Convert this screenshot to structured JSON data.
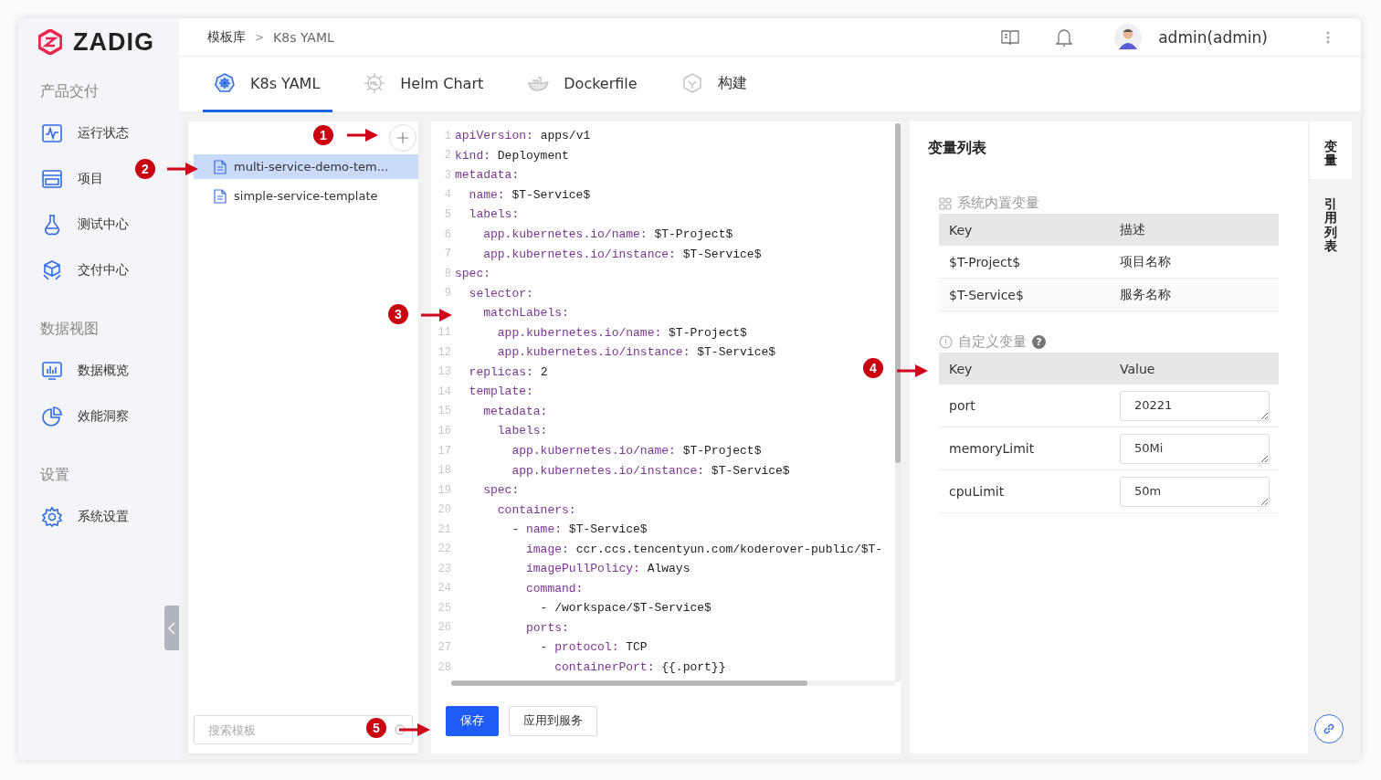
{
  "sidebar": {
    "logo": "ZADIG",
    "sections": [
      {
        "title": "产品交付",
        "items": [
          {
            "label": "运行状态"
          },
          {
            "label": "项目"
          },
          {
            "label": "测试中心"
          },
          {
            "label": "交付中心"
          }
        ]
      },
      {
        "title": "数据视图",
        "items": [
          {
            "label": "数据概览"
          },
          {
            "label": "效能洞察"
          }
        ]
      },
      {
        "title": "设置",
        "items": [
          {
            "label": "系统设置"
          }
        ]
      }
    ]
  },
  "header": {
    "breadcrumb": [
      "模板库",
      "K8s YAML"
    ],
    "separator": ">",
    "user": "admin(admin)"
  },
  "tabs": [
    {
      "label": "K8s YAML",
      "selected": true
    },
    {
      "label": "Helm Chart",
      "selected": false
    },
    {
      "label": "Dockerfile",
      "selected": false
    },
    {
      "label": "构建",
      "selected": false
    }
  ],
  "templates": {
    "items": [
      {
        "name": "multi-service-demo-tem...",
        "selected": true
      },
      {
        "name": "simple-service-template",
        "selected": false
      }
    ],
    "search": {
      "placeholder": "搜索模板"
    }
  },
  "editor": {
    "lines": [
      {
        "n": "1",
        "key": "apiVersion:",
        "value": " apps/v1"
      },
      {
        "n": "2",
        "key": "kind:",
        "value": " Deployment"
      },
      {
        "n": "3",
        "key": "metadata:"
      },
      {
        "n": "4",
        "key": "  name:",
        "value": " $T-Service$"
      },
      {
        "n": "5",
        "key": "  labels:"
      },
      {
        "n": "6",
        "key": "    app.kubernetes.io/name:",
        "value": " $T-Project$"
      },
      {
        "n": "7",
        "key": "    app.kubernetes.io/instance:",
        "value": " $T-Service$"
      },
      {
        "n": "8",
        "key": "spec:"
      },
      {
        "n": "9",
        "key": "  selector:"
      },
      {
        "key": "    matchLabels:"
      },
      {
        "n": "11",
        "key": "      app.kubernetes.io/name:",
        "value": " $T-Project$"
      },
      {
        "n": "12",
        "key": "      app.kubernetes.io/instance:",
        "value": " $T-Service$"
      },
      {
        "n": "13",
        "key": "  replicas:",
        "value": " 2"
      },
      {
        "n": "14",
        "key": "  template:"
      },
      {
        "n": "15",
        "key": "    metadata:"
      },
      {
        "n": "16",
        "key": "      labels:"
      },
      {
        "n": "17",
        "key": "        app.kubernetes.io/name:",
        "value": " $T-Project$"
      },
      {
        "n": "18",
        "key": "        app.kubernetes.io/instance:",
        "value": " $T-Service$"
      },
      {
        "n": "19",
        "key": "    spec:"
      },
      {
        "n": "20",
        "key": "      containers:"
      },
      {
        "n": "21",
        "prefix": "        - ",
        "key": "name:",
        "value": " $T-Service$"
      },
      {
        "n": "22",
        "key": "          image:",
        "value": " ccr.ccs.tencentyun.com/koderover-public/$T-"
      },
      {
        "n": "23",
        "key": "          imagePullPolicy:",
        "value": " Always"
      },
      {
        "n": "24",
        "key": "          command:"
      },
      {
        "n": "25",
        "prefix": "            - ",
        "value": "/workspace/$T-Service$"
      },
      {
        "n": "26",
        "key": "          ports:"
      },
      {
        "n": "27",
        "prefix": "            - ",
        "key": "protocol:",
        "value": " TCP"
      },
      {
        "n": "28",
        "key": "              containerPort:",
        "value": " {{.port}}"
      }
    ],
    "buttons": [
      {
        "label": "保存",
        "kind": "primary"
      },
      {
        "label": "应用到服务",
        "kind": "default"
      }
    ]
  },
  "variables": {
    "title": "变量列表",
    "system": {
      "title": "系统内置变量",
      "columns": [
        "Key",
        "描述"
      ],
      "rows": [
        {
          "key": "$T-Project$",
          "description": "项目名称"
        },
        {
          "key": "$T-Service$",
          "description": "服务名称"
        }
      ]
    },
    "custom": {
      "title": "自定义变量",
      "help": "?",
      "columns": [
        "Key",
        "Value"
      ],
      "rows": [
        {
          "key": "port",
          "value": "20221"
        },
        {
          "key": "memoryLimit",
          "value": "50Mi"
        },
        {
          "key": "cpuLimit",
          "value": "50m"
        }
      ]
    }
  },
  "side_tabs": [
    {
      "label": "变量",
      "selected": true
    },
    {
      "label": "引用列表",
      "selected": false
    }
  ],
  "annotations": [
    {
      "label": "1"
    },
    {
      "label": "2"
    },
    {
      "label": "3"
    },
    {
      "label": "4"
    },
    {
      "label": "5"
    }
  ]
}
